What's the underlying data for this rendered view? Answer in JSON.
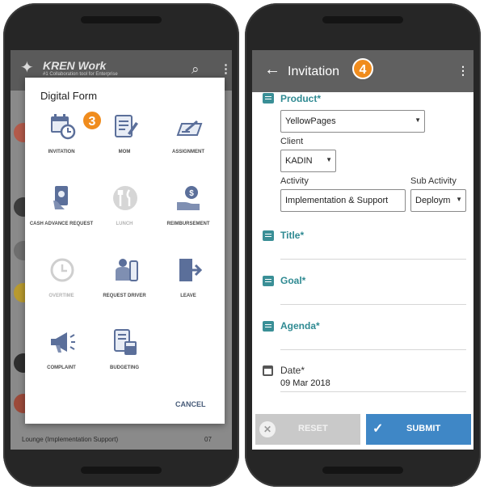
{
  "left_screen": {
    "app_title": "KREN Work",
    "app_subtitle": "#1 Collaboration tool for Enterprise",
    "background_item_text": "Lounge (Implementation Support)",
    "background_item_time": "07",
    "dialog": {
      "title": "Digital Form",
      "step_badge": "3",
      "items": [
        {
          "label": "INVITATION",
          "icon": "calendar-clock-icon",
          "enabled": true
        },
        {
          "label": "MOM",
          "icon": "notepad-pencil-icon",
          "enabled": true
        },
        {
          "label": "ASSIGNMENT",
          "icon": "clipboard-pen-icon",
          "enabled": true
        },
        {
          "label": "CASH ADVANCE REQUEST",
          "icon": "cash-hand-icon",
          "enabled": true
        },
        {
          "label": "LUNCH",
          "icon": "fork-knife-icon",
          "enabled": false
        },
        {
          "label": "REIMBURSEMENT",
          "icon": "coin-hand-icon",
          "enabled": true
        },
        {
          "label": "OVERTIME",
          "icon": "clock-icon",
          "enabled": false
        },
        {
          "label": "REQUEST DRIVER",
          "icon": "driver-icon",
          "enabled": true
        },
        {
          "label": "LEAVE",
          "icon": "exit-door-icon",
          "enabled": true
        },
        {
          "label": "COMPLAINT",
          "icon": "megaphone-icon",
          "enabled": true
        },
        {
          "label": "BUDGETING",
          "icon": "calculator-doc-icon",
          "enabled": true
        }
      ],
      "cancel_label": "CANCEL"
    }
  },
  "right_screen": {
    "appbar_title": "Invitation",
    "step_badge": "4",
    "form": {
      "product_label": "Product*",
      "product_value": "YellowPages",
      "client_label": "Client",
      "client_value": "KADIN",
      "activity_label": "Activity",
      "activity_value": "Implementation & Support",
      "sub_activity_label": "Sub Activity",
      "sub_activity_value": "Deploym",
      "title_label": "Title*",
      "goal_label": "Goal*",
      "agenda_label": "Agenda*",
      "date_label": "Date*",
      "date_value": "09 Mar 2018"
    },
    "reset_label": "RESET",
    "submit_label": "SUBMIT"
  },
  "colors": {
    "accent_teal": "#2f8a92",
    "submit_blue": "#3f87c6",
    "badge_orange": "#f08c1d"
  }
}
